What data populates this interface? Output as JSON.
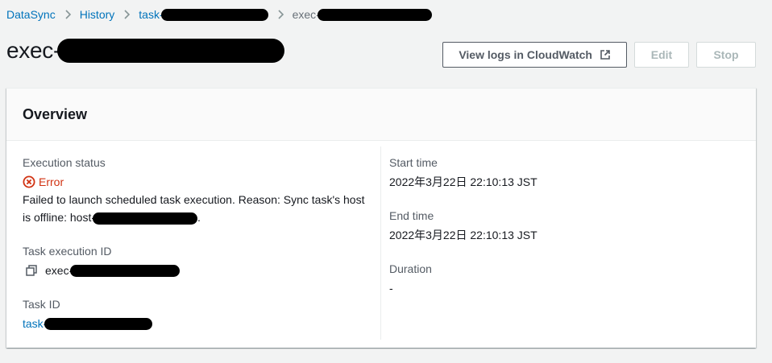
{
  "breadcrumb": {
    "root": "DataSync",
    "history": "History",
    "task": "task-",
    "exec": "exec-"
  },
  "page": {
    "title": "exec-"
  },
  "actions": {
    "view_logs_label": "View logs in CloudWatch",
    "edit_label": "Edit",
    "stop_label": "Stop"
  },
  "overview": {
    "title": "Overview",
    "execution_status_label": "Execution status",
    "status": "Error",
    "status_message_part1": "Failed to launch scheduled task execution. Reason: Sync task's host is offline: host-",
    "status_message_part2": ".",
    "task_execution_id_label": "Task execution ID",
    "task_execution_id": "exec-",
    "task_id_label": "Task ID",
    "task_id": "task-",
    "start_time_label": "Start time",
    "start_time": "2022年3月22日 22:10:13 JST",
    "end_time_label": "End time",
    "end_time": "2022年3月22日 22:10:13 JST",
    "duration_label": "Duration",
    "duration": "-"
  },
  "colors": {
    "link": "#0073bb",
    "error": "#d13212",
    "background": "#f2f3f3"
  },
  "icons": {
    "breadcrumb_separator": "chevron-right-icon",
    "external_link": "external-link-icon",
    "status_error": "error-circle-icon",
    "copy": "copy-icon"
  }
}
